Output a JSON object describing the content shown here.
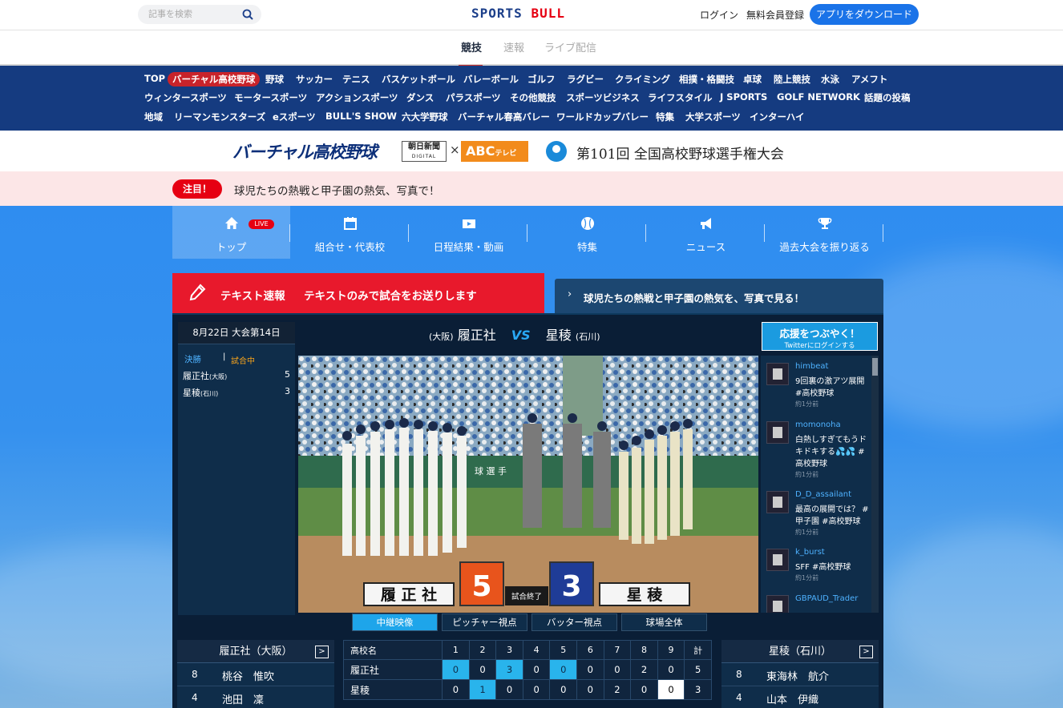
{
  "header": {
    "search_placeholder": "記事を検索",
    "logo_a": "SPORTS ",
    "logo_b": "BULL",
    "login": "ログイン",
    "register": "無料会員登録",
    "app_button": "アプリをダウンロード"
  },
  "subnav": {
    "tabs": [
      "競技",
      "速報",
      "ライブ配信"
    ],
    "active": "競技"
  },
  "categories": [
    [
      "TOP",
      "バーチャル高校野球",
      "野球",
      "サッカー",
      "テニス",
      "バスケットボール",
      "バレーボール",
      "ゴルフ",
      "ラグビー",
      "クライミング",
      "相撲・格闘技",
      "卓球",
      "陸上競技",
      "水泳",
      "アメフト"
    ],
    [
      "ウィンタースポーツ",
      "モータースポーツ",
      "アクションスポーツ",
      "ダンス",
      "パラスポーツ",
      "その他競技",
      "スポーツビジネス",
      "ライフスタイル",
      "J SPORTS",
      "GOLF NETWORK",
      "話題の投稿"
    ],
    [
      "地域",
      "リーマンモンスターズ",
      "eスポーツ",
      "BULL'S SHOW",
      "六大学野球",
      "バーチャル春高バレー",
      "ワールドカップバレー",
      "特集",
      "大学スポーツ",
      "インターハイ"
    ]
  ],
  "banner": {
    "title": "バーチャル高校野球",
    "asahi": "朝日新聞",
    "asahi_sub": "DIGITAL",
    "times": "×",
    "abc": "ABC",
    "abc_sub": "テレビ",
    "tournament": "第101回 全国高校野球選手権大会"
  },
  "alert": {
    "badge": "注目！",
    "text": "球児たちの熱戦と甲子園の熱気、写真で！"
  },
  "tabs": [
    {
      "label": "トップ",
      "icon": "home-icon",
      "live": "LIVE"
    },
    {
      "label": "組合せ・代表校",
      "icon": "calendar-icon"
    },
    {
      "label": "日程結果・動画",
      "icon": "video-icon"
    },
    {
      "label": "特集",
      "icon": "baseball-icon"
    },
    {
      "label": "ニュース",
      "icon": "megaphone-icon"
    },
    {
      "label": "過去大会を振り返る",
      "icon": "trophy-icon"
    }
  ],
  "text_feed": {
    "label": "テキスト速報",
    "desc": "テキストのみで試合をお送りします"
  },
  "photo_link": {
    "text": "球児たちの熱戦と甲子園の熱気を、写真で見る！"
  },
  "match": {
    "date": "8月22日 大会第14日",
    "round": "決勝",
    "separator": "|",
    "status": "試合中",
    "teams": [
      {
        "name": "履正社",
        "pref": "(大阪)",
        "score": "5"
      },
      {
        "name": "星稜",
        "pref": "(石川)",
        "score": "3"
      }
    ],
    "vs": "VS",
    "title_left_pref": "(大阪)",
    "title_left": "履正社",
    "title_right": "星稜",
    "title_right_pref": "(石川)"
  },
  "video_overlay": {
    "team_left": "履 正 社",
    "score_left": "5",
    "status": "試合終了",
    "score_right": "3",
    "team_right": "星 稜",
    "sign": "球 選 手"
  },
  "twitter": {
    "title": "応援をつぶやく！",
    "sub": "Twitterにログインする"
  },
  "tweets": [
    {
      "user": "himbeat",
      "text": "9回裏の激アツ展開 #高校野球",
      "time": "約1分前"
    },
    {
      "user": "momonoha",
      "text": "白熱しすぎてもうドキドキする💦💦 #高校野球",
      "time": "約1分前"
    },
    {
      "user": "D_D_assailant",
      "text": "最高の展開では？ #甲子園 #高校野球",
      "time": "約1分前"
    },
    {
      "user": "k_burst",
      "text": "SFF #高校野球",
      "time": "約1分前"
    },
    {
      "user": "GBPAUD_Trader",
      "text": "",
      "time": ""
    }
  ],
  "camera_tabs": [
    "中継映像",
    "ピッチャー視点",
    "バッター視点",
    "球場全体"
  ],
  "roster_left": {
    "title": "履正社（大阪）",
    "btn": ">",
    "players": [
      {
        "num": "8",
        "name": "桃谷　惟吹"
      },
      {
        "num": "4",
        "name": "池田　凜"
      }
    ]
  },
  "roster_right": {
    "title": "星稜（石川）",
    "btn": ">",
    "players": [
      {
        "num": "8",
        "name": "東海林　航介"
      },
      {
        "num": "4",
        "name": "山本　伊織"
      }
    ]
  },
  "scoreboard": {
    "header": [
      "高校名",
      "1",
      "2",
      "3",
      "4",
      "5",
      "6",
      "7",
      "8",
      "9",
      "計"
    ],
    "rows": [
      {
        "team": "履正社",
        "innings": [
          "0",
          "0",
          "3",
          "0",
          "0",
          "0",
          "0",
          "2",
          "0"
        ],
        "total": "5"
      },
      {
        "team": "星稜",
        "innings": [
          "0",
          "1",
          "0",
          "0",
          "0",
          "0",
          "2",
          "0",
          "0"
        ],
        "total": "3"
      }
    ]
  },
  "colors": {
    "brand_blue": "#153b80",
    "accent_red": "#e60012",
    "sky": "#2f8df0",
    "highlight": "#29b4ec"
  }
}
